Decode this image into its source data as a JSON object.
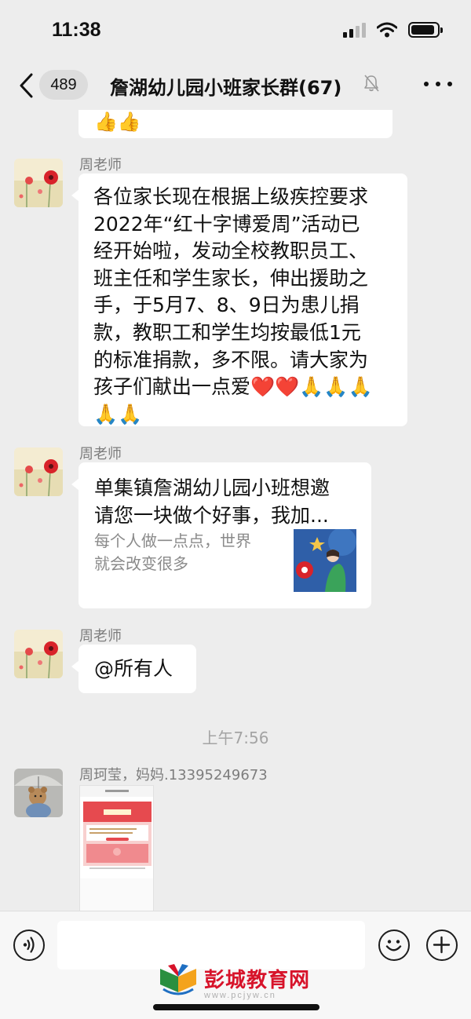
{
  "status_bar": {
    "time": "11:38",
    "signal_icon": "cellular-signal-icon",
    "wifi_icon": "wifi-icon",
    "battery_icon": "battery-icon",
    "battery_level": 0.9
  },
  "nav": {
    "back_icon": "chevron-left-icon",
    "unread_count": "489",
    "title": "詹湖幼儿园小班家长群(67)",
    "mute_icon": "bell-slash-icon",
    "more_icon": "ellipsis-icon"
  },
  "messages": [
    {
      "sender": "周老师",
      "text": "各位家长现在根据上级疾控要求\n2022年“红十字博爱周”活动已\n经开始啦，发动全校教职员工、\n班主任和学生家长，伸出援助之\n手，于5月7、8、9日为患儿捐\n款，教职工和学生均按最低1元\n的标准捐款，多不限。请大家为\n孩子们献出一点爱❤️❤️🙏🙏🙏\n🙏🙏"
    },
    {
      "sender": "周老师",
      "link_title": "单集镇詹湖幼儿园小班想邀\n请您一块做个好事，我加...",
      "link_desc": "每个人做一点点，世界\n就会改变很多"
    },
    {
      "sender": "周老师",
      "text": "@所有人"
    },
    {
      "sender": "周珂莹，妈妈.13395249673"
    }
  ],
  "previous_message": {
    "emoji": "👍👍"
  },
  "time_divider": "上午7:56",
  "input_bar": {
    "voice_icon": "voice-icon",
    "emoji_icon": "smiley-icon",
    "plus_icon": "plus-circle-icon"
  },
  "watermark": {
    "name": "彭城教育网",
    "url": "www.pcjyw.cn"
  },
  "colors": {
    "background": "#ededed",
    "bubble": "#ffffff",
    "secondary_text": "#7d7d7d",
    "watermark_red": "#d7132a"
  }
}
